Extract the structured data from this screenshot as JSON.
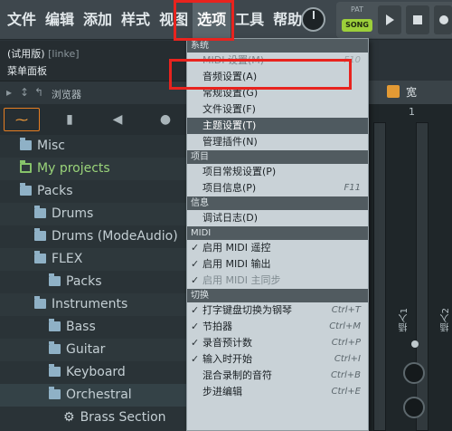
{
  "menubar": {
    "items": [
      "文件",
      "编辑",
      "添加",
      "样式",
      "视图",
      "选项",
      "工具",
      "帮助"
    ],
    "active_index": 5,
    "transport": {
      "pat_label": "PAT",
      "song_label": "SONG"
    }
  },
  "hint": {
    "title_prefix": "(试用版)",
    "title_muted": "[linke]",
    "subtitle": "菜单面板"
  },
  "browser": {
    "title": "浏览器",
    "tree": [
      {
        "label": "Misc",
        "indent": 0,
        "icon": "folder"
      },
      {
        "label": "My projects",
        "indent": 0,
        "icon": "folder-green"
      },
      {
        "label": "Packs",
        "indent": 0,
        "icon": "folder"
      },
      {
        "label": "Drums",
        "indent": 1,
        "icon": "folder"
      },
      {
        "label": "Drums (ModeAudio)",
        "indent": 1,
        "icon": "folder"
      },
      {
        "label": "FLEX",
        "indent": 1,
        "icon": "folder"
      },
      {
        "label": "Packs",
        "indent": 2,
        "icon": "folder"
      },
      {
        "label": "Instruments",
        "indent": 1,
        "icon": "folder"
      },
      {
        "label": "Bass",
        "indent": 2,
        "icon": "folder"
      },
      {
        "label": "Guitar",
        "indent": 2,
        "icon": "folder"
      },
      {
        "label": "Keyboard",
        "indent": 2,
        "icon": "folder"
      },
      {
        "label": "Orchestral",
        "indent": 2,
        "icon": "folder"
      },
      {
        "label": "Brass Section",
        "indent": 3,
        "icon": "gear"
      }
    ]
  },
  "playlist": {
    "label": "宽",
    "bar_number": "1",
    "insert_labels": [
      "插入1",
      "插入2"
    ]
  },
  "dropdown": {
    "sections": [
      {
        "title": "系统",
        "items": [
          {
            "label": "MIDI 设置(M)",
            "shortcut": "F10",
            "state": "faded"
          },
          {
            "label": "音频设置(A)"
          },
          {
            "label": "常规设置(G)"
          },
          {
            "label": "文件设置(F)"
          },
          {
            "label": "主题设置(T)",
            "state": "hl"
          },
          {
            "label": "管理插件(N)"
          }
        ]
      },
      {
        "title": "项目",
        "items": [
          {
            "label": "项目常规设置(P)"
          },
          {
            "label": "项目信息(P)",
            "shortcut": "F11"
          }
        ]
      },
      {
        "title": "信息",
        "items": [
          {
            "label": "调试日志(D)"
          }
        ]
      },
      {
        "title": "MIDI",
        "items": [
          {
            "label": "启用 MIDI 遥控",
            "checked": true
          },
          {
            "label": "启用 MIDI 输出",
            "checked": true
          },
          {
            "label": "启用 MIDI 主同步",
            "checked": true,
            "state": "dim"
          }
        ]
      },
      {
        "title": "切换",
        "items": [
          {
            "label": "打字键盘切换为钢琴",
            "shortcut": "Ctrl+T",
            "checked": true
          },
          {
            "label": "节拍器",
            "shortcut": "Ctrl+M",
            "checked": true
          },
          {
            "label": "录音预计数",
            "shortcut": "Ctrl+P",
            "checked": true
          },
          {
            "label": "输入时开始",
            "shortcut": "Ctrl+I",
            "checked": true
          },
          {
            "label": "混合录制的音符",
            "shortcut": "Ctrl+B"
          },
          {
            "label": "步进编辑",
            "shortcut": "Ctrl+E"
          }
        ]
      }
    ]
  },
  "colors": {
    "accent_orange": "#e67e22",
    "annotation_red": "#e8231e",
    "song_green": "#9ccf3a"
  }
}
